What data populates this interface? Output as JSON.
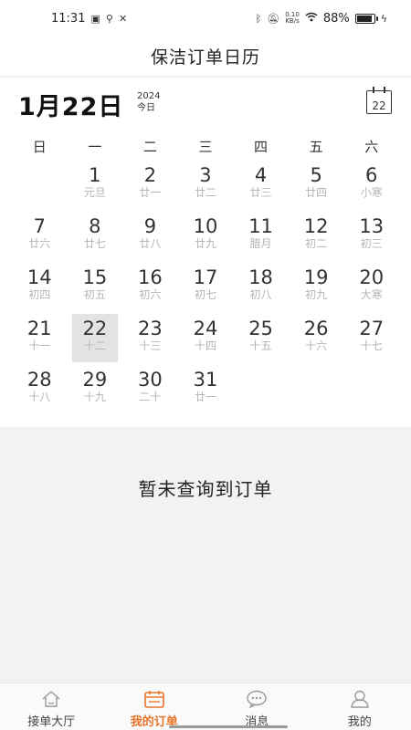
{
  "status_bar": {
    "time": "11:31",
    "net_speed_value": "0.10",
    "net_speed_unit": "KB/s",
    "battery": "88%"
  },
  "header": {
    "title": "保洁订单日历"
  },
  "calendar": {
    "big_date": "1月22日",
    "year": "2024",
    "today_label": "今日",
    "today_button": "22",
    "weekdays": [
      "日",
      "一",
      "二",
      "三",
      "四",
      "五",
      "六"
    ],
    "days": [
      {
        "num": "1",
        "lunar": "元旦"
      },
      {
        "num": "2",
        "lunar": "廿一"
      },
      {
        "num": "3",
        "lunar": "廿二"
      },
      {
        "num": "4",
        "lunar": "廿三"
      },
      {
        "num": "5",
        "lunar": "廿四"
      },
      {
        "num": "6",
        "lunar": "小寒"
      },
      {
        "num": "7",
        "lunar": "廿六"
      },
      {
        "num": "8",
        "lunar": "廿七"
      },
      {
        "num": "9",
        "lunar": "廿八"
      },
      {
        "num": "10",
        "lunar": "廿九"
      },
      {
        "num": "11",
        "lunar": "腊月"
      },
      {
        "num": "12",
        "lunar": "初二"
      },
      {
        "num": "13",
        "lunar": "初三"
      },
      {
        "num": "14",
        "lunar": "初四"
      },
      {
        "num": "15",
        "lunar": "初五"
      },
      {
        "num": "16",
        "lunar": "初六"
      },
      {
        "num": "17",
        "lunar": "初七"
      },
      {
        "num": "18",
        "lunar": "初八"
      },
      {
        "num": "19",
        "lunar": "初九"
      },
      {
        "num": "20",
        "lunar": "大寒"
      },
      {
        "num": "21",
        "lunar": "十一"
      },
      {
        "num": "22",
        "lunar": "十二"
      },
      {
        "num": "23",
        "lunar": "十三"
      },
      {
        "num": "24",
        "lunar": "十四"
      },
      {
        "num": "25",
        "lunar": "十五"
      },
      {
        "num": "26",
        "lunar": "十六"
      },
      {
        "num": "27",
        "lunar": "十七"
      },
      {
        "num": "28",
        "lunar": "十八"
      },
      {
        "num": "29",
        "lunar": "十九"
      },
      {
        "num": "30",
        "lunar": "二十"
      },
      {
        "num": "31",
        "lunar": "廿一"
      }
    ]
  },
  "main": {
    "empty_message": "暂未查询到订单"
  },
  "tabs": [
    {
      "label": "接单大厅",
      "icon": "home-icon"
    },
    {
      "label": "我的订单",
      "icon": "calendar-icon"
    },
    {
      "label": "消息",
      "icon": "chat-bubble-icon"
    },
    {
      "label": "我的",
      "icon": "user-icon"
    }
  ],
  "colors": {
    "accent": "#e8742c",
    "selected_day_bg": "#e3e3e3",
    "lunar_text": "#b5b5b5"
  }
}
